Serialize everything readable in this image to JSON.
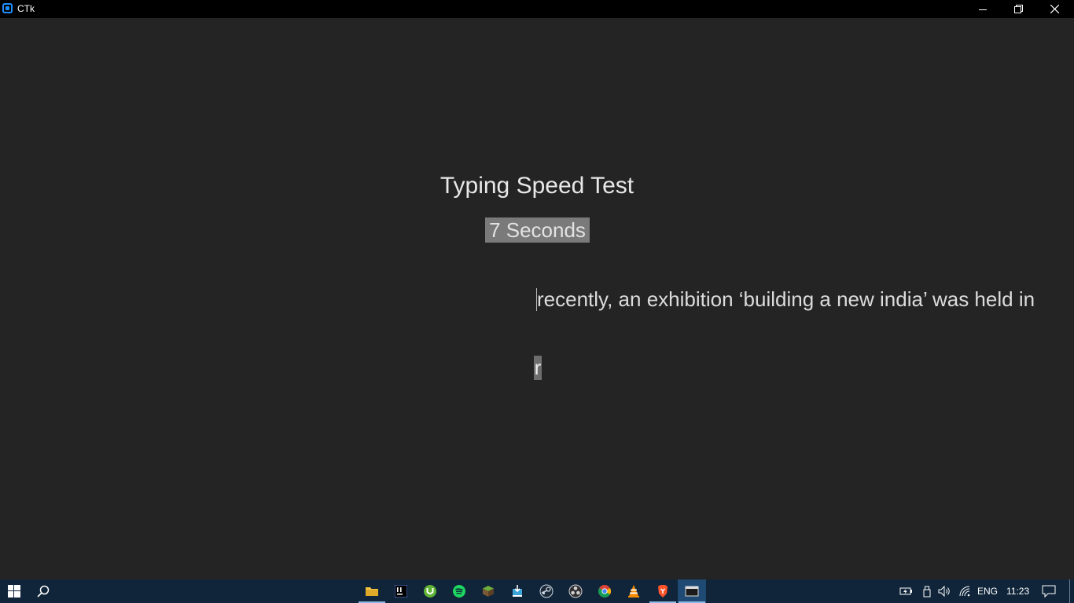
{
  "window": {
    "title": "CTk",
    "controls": {
      "minimize": "minimize",
      "restore": "restore",
      "close": "close"
    }
  },
  "app": {
    "heading": "Typing Speed Test",
    "timer": "7 Seconds",
    "sentence": "recently, an exhibition ‘building a new india’ was held in",
    "typed": "r"
  },
  "taskbar": {
    "apps": [
      {
        "name": "file-explorer",
        "active": true
      },
      {
        "name": "intellij-idea",
        "active": false
      },
      {
        "name": "utorrent",
        "active": false
      },
      {
        "name": "spotify",
        "active": false
      },
      {
        "name": "minecraft",
        "active": false
      },
      {
        "name": "installer",
        "active": false
      },
      {
        "name": "steam",
        "active": false
      },
      {
        "name": "obs-studio",
        "active": false
      },
      {
        "name": "chrome",
        "active": false
      },
      {
        "name": "vlc",
        "active": false
      },
      {
        "name": "brave",
        "active": true
      },
      {
        "name": "ctk-app",
        "active": true,
        "focused": true
      }
    ],
    "tray": {
      "language": "ENG",
      "time": "11:23"
    }
  },
  "colors": {
    "background": "#242424",
    "titlebar": "#000000",
    "taskbar": "#10253a",
    "timer_highlight": "#7a7a7a",
    "app_icon_accent": "#1f8fff"
  }
}
